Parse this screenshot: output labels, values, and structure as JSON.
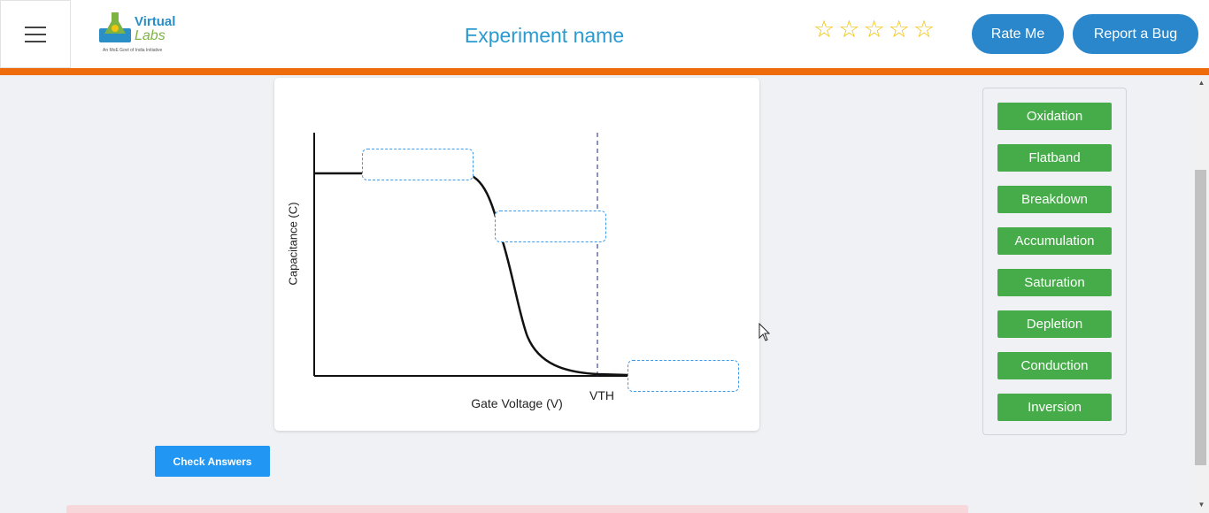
{
  "header": {
    "logo_top": "Virtual",
    "logo_bottom": "Labs",
    "logo_tagline": "An MoE Govt of India Initiative",
    "title": "Experiment name",
    "rating": {
      "stars_total": 5,
      "stars_filled": 0,
      "star_glyph": "☆"
    },
    "rate_label": "Rate Me",
    "bug_label": "Report a Bug"
  },
  "chart": {
    "ylabel": "Capacitance (C)",
    "xlabel": "Gate Voltage (V)",
    "vth_label": "VTH",
    "drop_zones": [
      "",
      "",
      ""
    ]
  },
  "options": [
    "Oxidation",
    "Flatband",
    "Breakdown",
    "Accumulation",
    "Saturation",
    "Depletion",
    "Conduction",
    "Inversion"
  ],
  "check_label": "Check Answers",
  "colors": {
    "accent_orange": "#ef6c0c",
    "button_blue": "#2a87cc",
    "option_green": "#46ac49",
    "title_blue": "#2a9bd0"
  }
}
